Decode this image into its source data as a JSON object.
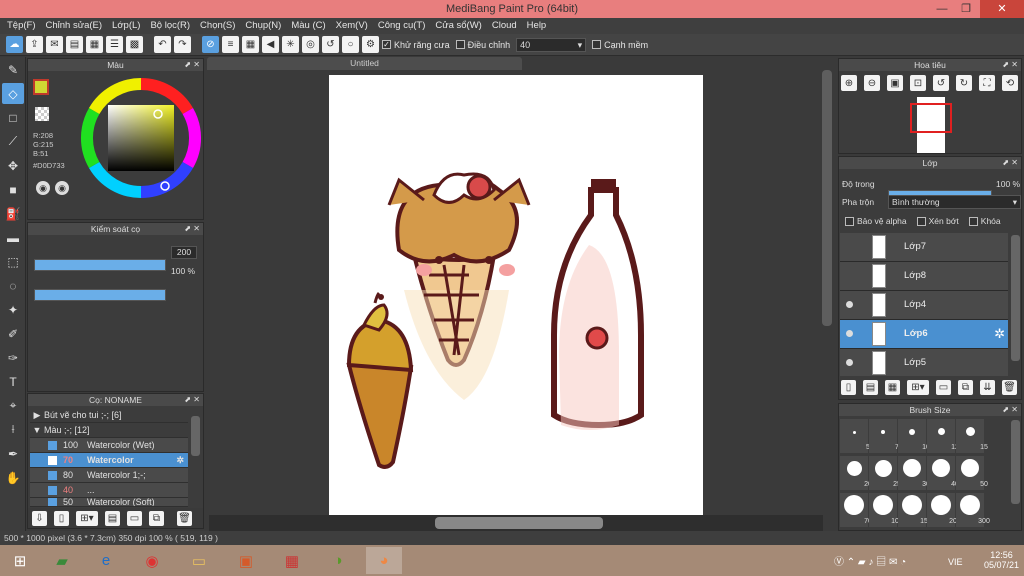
{
  "window": {
    "title": "MediBang Paint Pro (64bit)",
    "minimize": "—",
    "restore": "❐",
    "close": "✕"
  },
  "menu": [
    "Tệp(F)",
    "Chỉnh sửa(E)",
    "Lớp(L)",
    "Bộ lọc(R)",
    "Chọn(S)",
    "Chụp(N)",
    "Màu (C)",
    "Xem(V)",
    "Công cụ(T)",
    "Cửa sổ(W)",
    "Cloud",
    "Help"
  ],
  "toolbar": {
    "antialias_label": "Khử răng cưa",
    "antialias_checked": "✓",
    "adjust_label": "Điều chỉnh",
    "adjust_value": "40",
    "snap_label": "Cạnh mềm"
  },
  "color_panel": {
    "title": "Màu",
    "r": "R:208",
    "g": "G:215",
    "b": "B:51",
    "hex": "#D0D733",
    "primary_color": "#d0d733"
  },
  "brush_control": {
    "title": "Kiểm soát cọ",
    "size_value": "200",
    "opacity_value": "100 %"
  },
  "brush_panel": {
    "title": "Cọ: NONAME",
    "groups": [
      {
        "label": "Bút vẽ cho tui ;-; [6]",
        "arrow": "▶"
      },
      {
        "label": "Màu ;-; [12]",
        "arrow": "▼"
      }
    ],
    "items": [
      {
        "size": "100",
        "name": "Watercolor (Wet)",
        "selected": false
      },
      {
        "size": "70",
        "name": "Watercolor",
        "selected": true
      },
      {
        "size": "80",
        "name": "Watercolor 1;-;",
        "selected": false
      },
      {
        "size": "40",
        "name": "...",
        "selected": false
      },
      {
        "size": "50",
        "name": "Watercolor (Soft)",
        "selected": false
      }
    ]
  },
  "document": {
    "tab": "Untitled"
  },
  "navigator": {
    "title": "Hoa tiêu"
  },
  "layer_panel": {
    "title": "Lớp",
    "opacity_label": "Độ trong",
    "opacity_value": "100 %",
    "blend_label": "Pha trộn",
    "blend_value": "Bình thường",
    "protect_alpha": "Bảo vệ alpha",
    "clipping": "Xén bớt",
    "lock": "Khóa",
    "layers": [
      {
        "name": "Lớp7",
        "visible": false,
        "selected": false
      },
      {
        "name": "Lớp8",
        "visible": false,
        "selected": false
      },
      {
        "name": "Lớp4",
        "visible": true,
        "selected": false
      },
      {
        "name": "Lớp6",
        "visible": true,
        "selected": true
      },
      {
        "name": "Lớp5",
        "visible": true,
        "selected": false
      }
    ]
  },
  "brush_size": {
    "title": "Brush Size",
    "sizes": [
      "5",
      "7",
      "10",
      "12",
      "15",
      "20",
      "25",
      "30",
      "40",
      "50",
      "70",
      "100",
      "150",
      "200",
      "300"
    ]
  },
  "status": {
    "text": "500 * 1000 pixel  (3.6 * 7.3cm)   350 dpi   100 %   ( 519, 119 )"
  },
  "taskbar": {
    "lang": "VIE",
    "time": "12:56",
    "date": "05/07/21"
  }
}
